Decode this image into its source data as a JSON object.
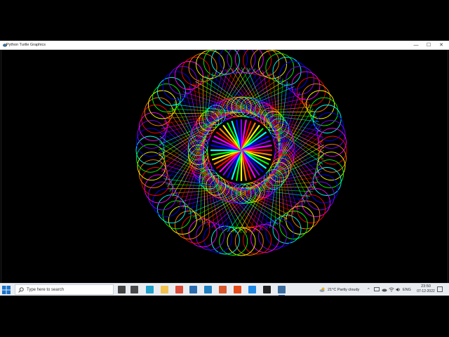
{
  "window": {
    "title": "Python Turtle Graphics",
    "minimize_glyph": "—",
    "maximize_glyph": "☐",
    "close_glyph": "✕"
  },
  "canvas": {
    "background": "#000000",
    "drawing": "turtle spirograph of rainbow circles and rays",
    "palette": [
      "#ff0000",
      "#ff8000",
      "#ffff00",
      "#00ff00",
      "#00ffff",
      "#0000ff",
      "#8000ff",
      "#ff00ff"
    ]
  },
  "taskbar": {
    "search_placeholder": "Type here to search",
    "pinned_apps": [
      {
        "name": "task-view-icon",
        "color": "#444444"
      },
      {
        "name": "widgets-icon",
        "color": "#4a4a4a"
      },
      {
        "name": "edge-icon",
        "color": "#1fa1c9"
      },
      {
        "name": "file-explorer-icon",
        "color": "#f2c14e"
      },
      {
        "name": "chrome-icon",
        "color": "#dd4b39"
      },
      {
        "name": "mail-icon",
        "color": "#2b6cb0"
      },
      {
        "name": "photos-icon",
        "color": "#1f7fc1"
      },
      {
        "name": "matlab-icon",
        "color": "#d9572b"
      },
      {
        "name": "office-icon",
        "color": "#e64a19"
      },
      {
        "name": "vscode-icon",
        "color": "#1e88e5"
      },
      {
        "name": "terminal-icon",
        "color": "#222222"
      },
      {
        "name": "python-turtle-icon",
        "color": "#3c6e9f"
      }
    ],
    "weather": "21°C  Partly cloudy",
    "chevron": "^",
    "language": "ENG",
    "time": "23:50",
    "date": "07-12-2022"
  }
}
